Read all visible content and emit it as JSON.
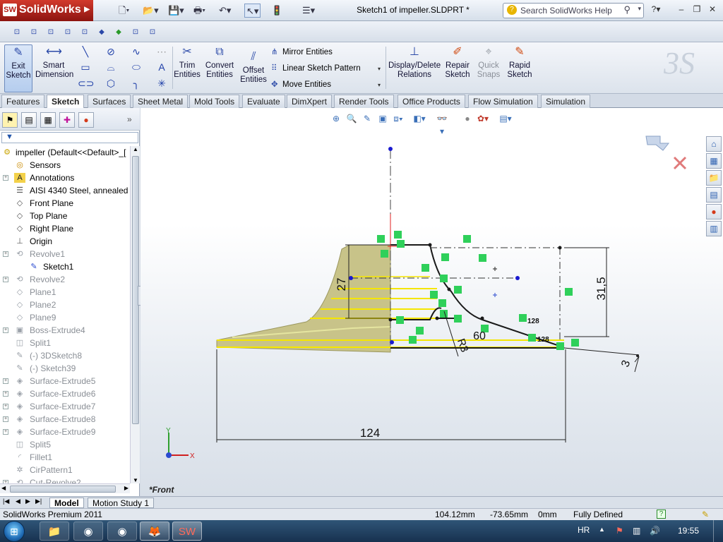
{
  "app": {
    "brand": "SolidWorks",
    "document_title": "Sketch1 of impeller.SLDPRT *",
    "help_placeholder": "Search SolidWorks Help"
  },
  "command_manager": {
    "exit_sketch": "Exit Sketch",
    "smart_dimension": "Smart Dimension",
    "trim_entities": "Trim Entities",
    "convert_entities": "Convert Entities",
    "offset_entities": "Offset Entities",
    "mirror_entities": "Mirror Entities",
    "linear_sketch_pattern": "Linear Sketch Pattern",
    "move_entities": "Move Entities",
    "display_delete_relations": "Display/Delete Relations",
    "repair_sketch": "Repair Sketch",
    "quick_snaps": "Quick Snaps",
    "rapid_sketch": "Rapid Sketch"
  },
  "tabs": [
    "Features",
    "Sketch",
    "Surfaces",
    "Sheet Metal",
    "Mold Tools",
    "Evaluate",
    "DimXpert",
    "Render Tools",
    "Office Products",
    "Flow Simulation",
    "Simulation"
  ],
  "active_tab": "Sketch",
  "feature_tree": {
    "root": "impeller  (Default<<Default>_[",
    "items": [
      {
        "label": "Sensors",
        "icon": "sensor-icon",
        "grey": false,
        "expand": false
      },
      {
        "label": "Annotations",
        "icon": "annotation-icon",
        "grey": false,
        "expand": true
      },
      {
        "label": "AISI 4340 Steel, annealed",
        "icon": "material-icon",
        "grey": false,
        "expand": false
      },
      {
        "label": "Front Plane",
        "icon": "plane-icon",
        "grey": false,
        "expand": false
      },
      {
        "label": "Top Plane",
        "icon": "plane-icon",
        "grey": false,
        "expand": false
      },
      {
        "label": "Right Plane",
        "icon": "plane-icon",
        "grey": false,
        "expand": false
      },
      {
        "label": "Origin",
        "icon": "origin-icon",
        "grey": false,
        "expand": false
      },
      {
        "label": "Revolve1",
        "icon": "revolve-icon",
        "grey": true,
        "expand": true
      },
      {
        "label": "Sketch1",
        "icon": "sketch-icon",
        "grey": false,
        "expand": false,
        "indent": true
      },
      {
        "label": "Revolve2",
        "icon": "revolve-icon",
        "grey": true,
        "expand": true
      },
      {
        "label": "Plane1",
        "icon": "plane-icon",
        "grey": true,
        "expand": false
      },
      {
        "label": "Plane2",
        "icon": "plane-icon",
        "grey": true,
        "expand": false
      },
      {
        "label": "Plane9",
        "icon": "plane-icon",
        "grey": true,
        "expand": false
      },
      {
        "label": "Boss-Extrude4",
        "icon": "extrude-icon",
        "grey": true,
        "expand": true
      },
      {
        "label": "Split1",
        "icon": "split-icon",
        "grey": true,
        "expand": false
      },
      {
        "label": "(-) 3DSketch8",
        "icon": "3dsketch-icon",
        "grey": true,
        "expand": false
      },
      {
        "label": "(-) Sketch39",
        "icon": "sketch-icon",
        "grey": true,
        "expand": false
      },
      {
        "label": "Surface-Extrude5",
        "icon": "surface-extrude-icon",
        "grey": true,
        "expand": true
      },
      {
        "label": "Surface-Extrude6",
        "icon": "surface-extrude-icon",
        "grey": true,
        "expand": true
      },
      {
        "label": "Surface-Extrude7",
        "icon": "surface-extrude-icon",
        "grey": true,
        "expand": true
      },
      {
        "label": "Surface-Extrude8",
        "icon": "surface-extrude-icon",
        "grey": true,
        "expand": true
      },
      {
        "label": "Surface-Extrude9",
        "icon": "surface-extrude-icon",
        "grey": true,
        "expand": true
      },
      {
        "label": "Split5",
        "icon": "split-icon",
        "grey": true,
        "expand": false
      },
      {
        "label": "Fillet1",
        "icon": "fillet-icon",
        "grey": true,
        "expand": false
      },
      {
        "label": "CirPattern1",
        "icon": "pattern-icon",
        "grey": true,
        "expand": false
      },
      {
        "label": "Cut-Revolve2",
        "icon": "cut-revolve-icon",
        "grey": true,
        "expand": true
      }
    ]
  },
  "sketch": {
    "dim_27": "27",
    "dim_31_5": "31,5",
    "dim_124": "124",
    "dim_r3": "R3",
    "dim_60": "60",
    "dim_3": "3",
    "label_128a": "128",
    "label_128b": "128",
    "axis_x": "X",
    "axis_y": "Y"
  },
  "view_name": "*Front",
  "bottom_tabs": [
    "Model",
    "Motion Study 1"
  ],
  "status": {
    "product": "SolidWorks Premium 2011",
    "x": "104.12mm",
    "y": "-73.65mm",
    "z": "0mm",
    "state": "Fully Defined"
  },
  "taskbar": {
    "language": "HR",
    "clock": "19:55"
  },
  "colors": {
    "part_fill": "#c9c48a",
    "sketch_line": "#1a1a1a",
    "relation_marker": "#2fd05a",
    "highlight_edge": "#f2e400",
    "accent_blue": "#2b4aa8"
  }
}
